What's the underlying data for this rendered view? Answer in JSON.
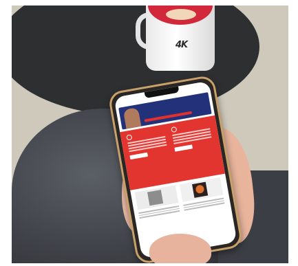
{
  "scene": {
    "mug_logo": "4K"
  },
  "colors": {
    "brand_red": "#e2352f",
    "banner_navy": "#23307a",
    "banner_yellow": "#f4d34b",
    "phone_case": "#c8a06a"
  },
  "icons": {
    "card_icon": "lightbulb-icon"
  }
}
